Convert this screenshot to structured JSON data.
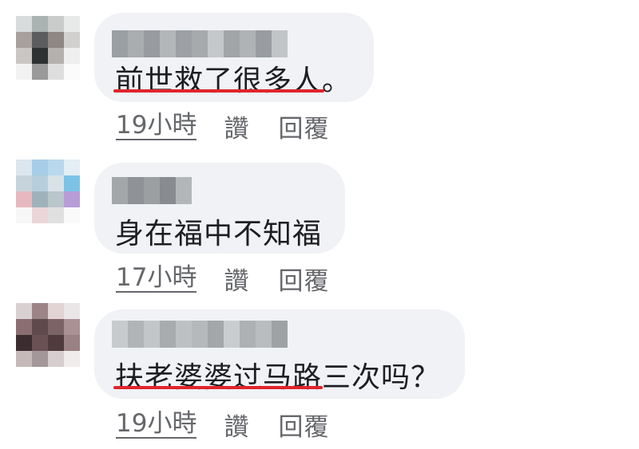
{
  "comments": [
    {
      "text": "前世救了很多人。",
      "time": "19小時",
      "like_label": "讚",
      "reply_label": "回覆"
    },
    {
      "text": "身在福中不知福",
      "time": "17小時",
      "like_label": "讚",
      "reply_label": "回覆"
    },
    {
      "text": "扶老婆婆过马路三次吗？",
      "time": "19小時",
      "like_label": "讚",
      "reply_label": "回覆"
    }
  ],
  "colors": {
    "bubble_bg": "#f0f2f5",
    "text": "#1c1e21",
    "meta": "#65676b",
    "highlight_underline": "#e0242c"
  }
}
